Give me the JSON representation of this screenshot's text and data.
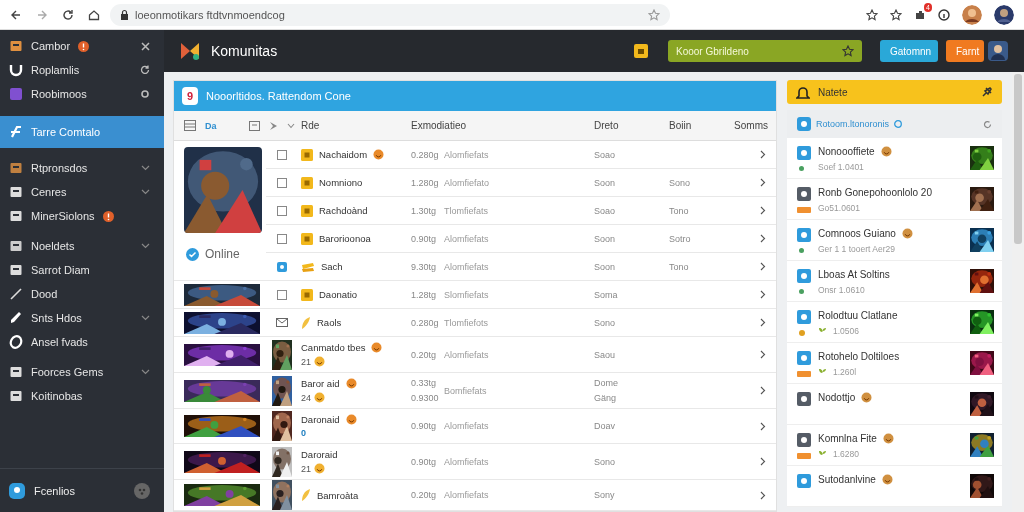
{
  "browser": {
    "url": "loeonmotikars ftdtvnmoendcog",
    "extension_badge": "4"
  },
  "sidebar": {
    "items": [
      {
        "label": "Cambor",
        "badge": true,
        "selected": false
      },
      {
        "label": "Roplamlis",
        "selected": false
      },
      {
        "label": "Roobimoos",
        "selected": false
      },
      {
        "label": "Tarre Comtalo",
        "selected": true
      },
      {
        "label": "Rtpronsdos",
        "expanded": false,
        "selected": false
      },
      {
        "label": "Cenres",
        "expanded": false,
        "selected": false
      },
      {
        "label": "MinerSiolons",
        "badge": true,
        "selected": false
      },
      {
        "label": "Noeldets",
        "expanded": false,
        "selected": false
      },
      {
        "label": "Sarrot Diam",
        "selected": false
      },
      {
        "label": "Dood",
        "selected": false
      },
      {
        "label": "Snts Hdos",
        "expanded": false,
        "selected": false
      },
      {
        "label": "Ansel fvads",
        "selected": false
      },
      {
        "label": "Foorces Gems",
        "expanded": false,
        "selected": false
      },
      {
        "label": "Koitinobas",
        "selected": false
      }
    ],
    "footer": {
      "label": "Fcenlios"
    }
  },
  "header": {
    "title": "Komunitas",
    "search": {
      "value": "Kooor Gbrildeno"
    },
    "buttons": [
      {
        "label": "Gatomnn",
        "kind": "primary"
      },
      {
        "label": "Farnt",
        "kind": "accent"
      }
    ]
  },
  "table_panel": {
    "title": "Nooorltidos. Rattendom Cone",
    "title_badge": "9",
    "toolbar_label": "Da",
    "columns": [
      "Rde",
      "Exmodiatieo",
      "Dreto",
      "Boiin",
      "Somms"
    ],
    "featured": {
      "status": "Online",
      "rows": [
        {
          "kind": "checkbox",
          "checked": false,
          "name": "Nachaidom",
          "badge": true,
          "amount": "0.280g",
          "desc": "Alomfiefats",
          "date": "Soao"
        },
        {
          "kind": "checkbox",
          "checked": false,
          "name": "Nomniono",
          "amount": "1.280g",
          "desc": "Alomfiefato",
          "date": "Soon",
          "status": "Sono"
        },
        {
          "kind": "checkbox",
          "checked": false,
          "name": "Rachdoànd",
          "amount": "1.30tg",
          "desc": "Tlomfiefats",
          "date": "Soao",
          "status": "Tono"
        },
        {
          "kind": "checkbox",
          "checked": false,
          "name": "Barorioonoa",
          "amount": "0.90tg",
          "desc": "Alomfiefats",
          "date": "Soon",
          "status": "Sotro"
        },
        {
          "kind": "tag",
          "name": "Sach",
          "amount": "9.30tg",
          "desc": "Alomfiefats",
          "date": "Soon",
          "status": "Tono"
        }
      ]
    },
    "rows": [
      {
        "kind": "checkbox",
        "checked": false,
        "name": "Daonatio",
        "amount": "1.28tg",
        "desc": "Slomfiefats",
        "date": "Soma"
      },
      {
        "kind": "mail",
        "name": "Raols",
        "amount": "0.280g",
        "desc": "Tlomfiefots",
        "date": "Sono"
      },
      {
        "kind": "avatar",
        "name": "Canmatdo tbes",
        "badge": true,
        "sub": "21",
        "sub_badge": true,
        "amount": "0.20tg",
        "desc": "Alomfiefats",
        "date": "Saou"
      },
      {
        "kind": "avatar",
        "name": "Baror aid",
        "badge": true,
        "sub": "24",
        "sub_badge": true,
        "amount": "0.33tg",
        "amount_2": "0.9300",
        "desc": "Bomfiefats",
        "date": "Dome",
        "date_2": "Gäng"
      },
      {
        "kind": "avatar",
        "name": "Daronaid",
        "badge": true,
        "sub": "0",
        "amount": "0.90tg",
        "desc": "Alomfiefats",
        "date": "Doav"
      },
      {
        "kind": "avatar",
        "name": "Daroraid",
        "sub": "21",
        "sub_badge": true,
        "amount": "0.90tg",
        "desc": "Alomfiefats",
        "date": "Sono"
      },
      {
        "kind": "avatar",
        "name": "Bamroàta",
        "amount": "0.20tg",
        "desc": "Alomfiefats",
        "date": "Sony"
      }
    ]
  },
  "notices": {
    "title": "Natete",
    "subtitle": "Rotoom.ltonoronis",
    "items": [
      {
        "kind": "dot",
        "name": "Nonoooffiete",
        "badge": true,
        "detail": "Soef 1.0401",
        "color": "#2f9bdc"
      },
      {
        "kind": "tag",
        "name": "Ronb Gonepohoonlolo 20",
        "detail": "Go51.0601",
        "color": "#555c66"
      },
      {
        "kind": "dot",
        "name": "Comnoos Guiano",
        "badge": true,
        "detail": "Ger 1 1 tooert Aer29",
        "color": "#2f9bdc"
      },
      {
        "kind": "dot",
        "name": "Lboas At Soltins",
        "detail": "Onsr 1.0610",
        "color": "#2f9bdc"
      },
      {
        "kind": "coin",
        "name": "Rolodtuu Clatlane",
        "detail": "1.0506",
        "detail_icon": true,
        "color": "#2f9bdc"
      },
      {
        "kind": "tag",
        "name": "Rotohelo Doltiloes",
        "detail": "1.260l",
        "detail_icon": true,
        "color": "#2f9bdc"
      },
      {
        "kind": "plain",
        "name": "Nodottjo",
        "badge": true,
        "color": "#555c66"
      },
      {
        "kind": "tag",
        "name": "Komnlna Fite",
        "badge": true,
        "detail": "1.6280",
        "detail_icon": true,
        "color": "#555c66"
      },
      {
        "kind": "plain",
        "name": "Sutodanlvine",
        "badge": true,
        "color": "#2f9bdc"
      }
    ]
  }
}
